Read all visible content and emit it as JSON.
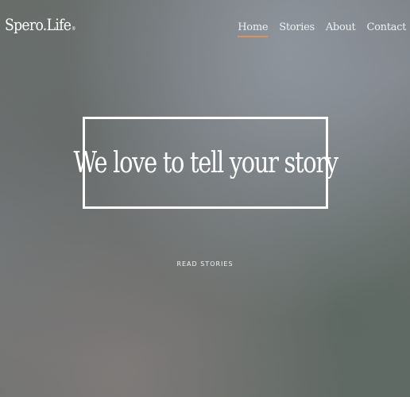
{
  "site": {
    "brand": "Spero.Life",
    "brand_mark": "®"
  },
  "nav": {
    "items": [
      {
        "label": "Home",
        "active": true
      },
      {
        "label": "Stories",
        "active": false
      },
      {
        "label": "About",
        "active": false
      },
      {
        "label": "Contact",
        "active": false
      }
    ]
  },
  "hero": {
    "headline": "We love to tell your story",
    "cta_label": "READ STORIES"
  },
  "colors": {
    "accent": "#e0905a",
    "text": "#ffffff"
  }
}
